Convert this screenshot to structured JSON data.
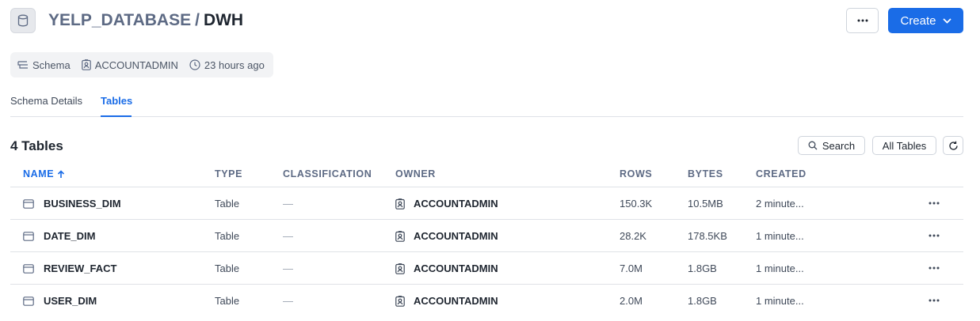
{
  "header": {
    "parent": "YELP_DATABASE",
    "separator": "/",
    "current": "DWH",
    "create_label": "Create"
  },
  "meta": {
    "type": "Schema",
    "owner": "ACCOUNTADMIN",
    "updated": "23 hours ago"
  },
  "tabs": [
    {
      "label": "Schema Details",
      "active": false
    },
    {
      "label": "Tables",
      "active": true
    }
  ],
  "tables_section": {
    "count_title": "4 Tables",
    "search_label": "Search",
    "filter_label": "All Tables"
  },
  "columns": {
    "name": "NAME",
    "type": "TYPE",
    "classification": "CLASSIFICATION",
    "owner": "OWNER",
    "rows": "ROWS",
    "bytes": "BYTES",
    "created": "CREATED"
  },
  "rows": [
    {
      "name": "BUSINESS_DIM",
      "type": "Table",
      "classification": "—",
      "owner": "ACCOUNTADMIN",
      "rows": "150.3K",
      "bytes": "10.5MB",
      "created": "2 minute..."
    },
    {
      "name": "DATE_DIM",
      "type": "Table",
      "classification": "—",
      "owner": "ACCOUNTADMIN",
      "rows": "28.2K",
      "bytes": "178.5KB",
      "created": "1 minute..."
    },
    {
      "name": "REVIEW_FACT",
      "type": "Table",
      "classification": "—",
      "owner": "ACCOUNTADMIN",
      "rows": "7.0M",
      "bytes": "1.8GB",
      "created": "1 minute..."
    },
    {
      "name": "USER_DIM",
      "type": "Table",
      "classification": "—",
      "owner": "ACCOUNTADMIN",
      "rows": "2.0M",
      "bytes": "1.8GB",
      "created": "1 minute..."
    }
  ],
  "icons": {
    "database": "database-icon",
    "more": "more-horizontal-icon",
    "chevron": "chevron-down-icon",
    "schema": "schema-icon",
    "owner": "owner-badge-icon",
    "clock": "clock-icon",
    "search": "search-icon",
    "refresh": "refresh-icon",
    "sort": "sort-ascending-icon",
    "table": "table-icon"
  },
  "colors": {
    "accent": "#1a6ce7",
    "muted": "#5d6a84"
  }
}
